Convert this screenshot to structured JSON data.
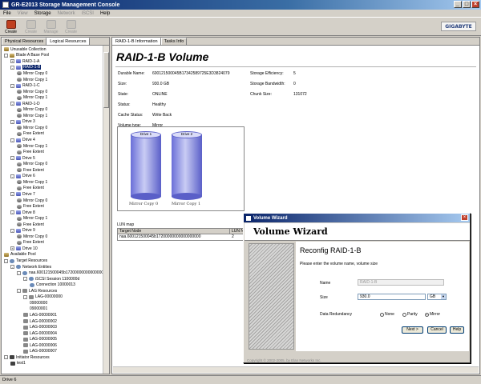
{
  "window": {
    "title": "GR-E2013 Storage Management Console",
    "controls": [
      "_",
      "□",
      "×"
    ]
  },
  "menu": [
    {
      "label": "File",
      "enabled": true
    },
    {
      "label": "View",
      "enabled": false
    },
    {
      "label": "Storage",
      "enabled": true
    },
    {
      "label": "Network",
      "enabled": false
    },
    {
      "label": "iSCSI",
      "enabled": false
    },
    {
      "label": "Help",
      "enabled": true
    }
  ],
  "toolbar": [
    {
      "label": "Create",
      "icon": "create-icon",
      "enabled": true
    },
    {
      "label": "Create",
      "icon": "create-icon",
      "enabled": false
    },
    {
      "label": "Manage",
      "icon": "manage-icon",
      "enabled": false
    },
    {
      "label": "Create",
      "icon": "create-icon",
      "enabled": false
    }
  ],
  "brand": "GIGABYTE",
  "left_tabs": [
    "Physical Resources",
    "Logical Resources"
  ],
  "tree": [
    {
      "depth": 0,
      "label": "Unusable Collection",
      "icon": "db",
      "toggle": ""
    },
    {
      "depth": 0,
      "label": "Blade A Base Pool",
      "icon": "db",
      "toggle": "-"
    },
    {
      "depth": 1,
      "label": "RAID-1-A",
      "icon": "disk",
      "toggle": "+"
    },
    {
      "depth": 1,
      "label": "RAID-1-B",
      "icon": "disk",
      "toggle": "-",
      "selected": true
    },
    {
      "depth": 2,
      "label": "Mirror Copy 0",
      "icon": "mirror",
      "toggle": ""
    },
    {
      "depth": 2,
      "label": "Mirror Copy 1",
      "icon": "mirror",
      "toggle": ""
    },
    {
      "depth": 1,
      "label": "RAID-1-C",
      "icon": "disk",
      "toggle": "-"
    },
    {
      "depth": 2,
      "label": "Mirror Copy 0",
      "icon": "mirror",
      "toggle": ""
    },
    {
      "depth": 2,
      "label": "Mirror Copy 1",
      "icon": "mirror",
      "toggle": ""
    },
    {
      "depth": 1,
      "label": "RAID-1-D",
      "icon": "disk",
      "toggle": "-"
    },
    {
      "depth": 2,
      "label": "Mirror Copy 0",
      "icon": "mirror",
      "toggle": ""
    },
    {
      "depth": 2,
      "label": "Mirror Copy 1",
      "icon": "mirror",
      "toggle": ""
    },
    {
      "depth": 1,
      "label": "Drive 3",
      "icon": "disk",
      "toggle": "-"
    },
    {
      "depth": 2,
      "label": "Mirror Copy 0",
      "icon": "mirror",
      "toggle": ""
    },
    {
      "depth": 2,
      "label": "Free Extent",
      "icon": "mirror",
      "toggle": ""
    },
    {
      "depth": 1,
      "label": "Drive 4",
      "icon": "disk",
      "toggle": "-"
    },
    {
      "depth": 2,
      "label": "Mirror Copy 1",
      "icon": "mirror",
      "toggle": ""
    },
    {
      "depth": 2,
      "label": "Free Extent",
      "icon": "mirror",
      "toggle": ""
    },
    {
      "depth": 1,
      "label": "Drive 5",
      "icon": "disk",
      "toggle": "-"
    },
    {
      "depth": 2,
      "label": "Mirror Copy 0",
      "icon": "mirror",
      "toggle": ""
    },
    {
      "depth": 2,
      "label": "Free Extent",
      "icon": "mirror",
      "toggle": ""
    },
    {
      "depth": 1,
      "label": "Drive 6",
      "icon": "disk",
      "toggle": "-"
    },
    {
      "depth": 2,
      "label": "Mirror Copy 1",
      "icon": "mirror",
      "toggle": ""
    },
    {
      "depth": 2,
      "label": "Free Extent",
      "icon": "mirror",
      "toggle": ""
    },
    {
      "depth": 1,
      "label": "Drive 7",
      "icon": "disk",
      "toggle": "-"
    },
    {
      "depth": 2,
      "label": "Mirror Copy 0",
      "icon": "mirror",
      "toggle": ""
    },
    {
      "depth": 2,
      "label": "Free Extent",
      "icon": "mirror",
      "toggle": ""
    },
    {
      "depth": 1,
      "label": "Drive 8",
      "icon": "disk",
      "toggle": "-"
    },
    {
      "depth": 2,
      "label": "Mirror Copy 1",
      "icon": "mirror",
      "toggle": ""
    },
    {
      "depth": 2,
      "label": "Free Extent",
      "icon": "mirror",
      "toggle": ""
    },
    {
      "depth": 1,
      "label": "Drive 9",
      "icon": "disk",
      "toggle": "-"
    },
    {
      "depth": 2,
      "label": "Mirror Copy 0",
      "icon": "mirror",
      "toggle": ""
    },
    {
      "depth": 2,
      "label": "Free Extent",
      "icon": "mirror",
      "toggle": ""
    },
    {
      "depth": 1,
      "label": "Drive 10",
      "icon": "disk",
      "toggle": "+"
    },
    {
      "depth": 0,
      "label": "Available Pool",
      "icon": "db",
      "toggle": ""
    },
    {
      "depth": 0,
      "label": "Target Resources",
      "icon": "net",
      "toggle": "-"
    },
    {
      "depth": 1,
      "label": "Network Entities",
      "icon": "net",
      "toggle": "-"
    },
    {
      "depth": 2,
      "label": "naa.600121500045b17200000000000000000",
      "icon": "net",
      "toggle": "-"
    },
    {
      "depth": 3,
      "label": "iSCSI Session 1100000d",
      "icon": "net",
      "toggle": "-"
    },
    {
      "depth": 4,
      "label": "Connection 10000013",
      "icon": "net",
      "toggle": ""
    },
    {
      "depth": 2,
      "label": "LAG Resources",
      "icon": "lag",
      "toggle": "-"
    },
    {
      "depth": 3,
      "label": "LAG-00000000",
      "icon": "lag",
      "toggle": "-"
    },
    {
      "depth": 4,
      "label": "09000000",
      "icon": "",
      "toggle": ""
    },
    {
      "depth": 4,
      "label": "09000001",
      "icon": "",
      "toggle": ""
    },
    {
      "depth": 3,
      "label": "LAG-00000001",
      "icon": "lag",
      "toggle": ""
    },
    {
      "depth": 3,
      "label": "LAG-00000002",
      "icon": "lag",
      "toggle": ""
    },
    {
      "depth": 3,
      "label": "LAG-00000003",
      "icon": "lag",
      "toggle": ""
    },
    {
      "depth": 3,
      "label": "LAG-00000004",
      "icon": "lag",
      "toggle": ""
    },
    {
      "depth": 3,
      "label": "LAG-00000005",
      "icon": "lag",
      "toggle": ""
    },
    {
      "depth": 3,
      "label": "LAG-00000006",
      "icon": "lag",
      "toggle": ""
    },
    {
      "depth": 3,
      "label": "LAG-00000007",
      "icon": "lag",
      "toggle": ""
    },
    {
      "depth": 0,
      "label": "Initiator Resources",
      "icon": "init",
      "toggle": "-"
    },
    {
      "depth": 1,
      "label": "test1",
      "icon": "init",
      "toggle": ""
    }
  ],
  "right_tabs": [
    "RAID-1-B Information",
    "Tasks Info"
  ],
  "volume": {
    "title": "RAID-1-B Volume",
    "props_left": [
      {
        "label": "Durable Name:",
        "value": "600121500045B17342589725E3D3824079"
      },
      {
        "label": "Size:",
        "value": "930.0 GB"
      },
      {
        "label": "State:",
        "value": "ONLINE"
      },
      {
        "label": "Status:",
        "value": "Healthy"
      },
      {
        "label": "Cache Status:",
        "value": "Write Back"
      },
      {
        "label": "Volume type:",
        "value": "Mirror"
      }
    ],
    "props_right": [
      {
        "label": "Storage Efficiency:",
        "value": "5"
      },
      {
        "label": "Storage Bandwidth:",
        "value": "0"
      },
      {
        "label": "Chunk Size:",
        "value": "131072"
      }
    ],
    "cylinders": [
      {
        "cap": "Drive 1",
        "label": "Mirror Copy 0"
      },
      {
        "cap": "Drive 2",
        "label": "Mirror Copy 1"
      }
    ],
    "lun_map_label": "LUN map",
    "lun_columns": [
      "Target Node",
      "LUN Nu"
    ],
    "lun_rows": [
      [
        "naa.600121500045b17200000000000000000",
        "2"
      ]
    ]
  },
  "wizard": {
    "title": "Volume Wizard",
    "header": "Volume Wizard",
    "subtitle": "Reconfig RAID-1-B",
    "description": "Please enter the volume name, volume size",
    "name_label": "Name",
    "name_value": "RAID-1-B",
    "size_label": "Size",
    "size_value": "930.0",
    "size_unit": "GB",
    "redundancy_label": "Data Redundancy",
    "redundancy_options": [
      "None",
      "Parity",
      "Mirror"
    ],
    "redundancy_selected": "Mirror",
    "next_label": "Next  >",
    "cancel_label": "Cancel",
    "help_label": "Help",
    "copyright": "Copyright © 2002-2005, by Elan Networks Inc."
  },
  "status": "Drive 6"
}
